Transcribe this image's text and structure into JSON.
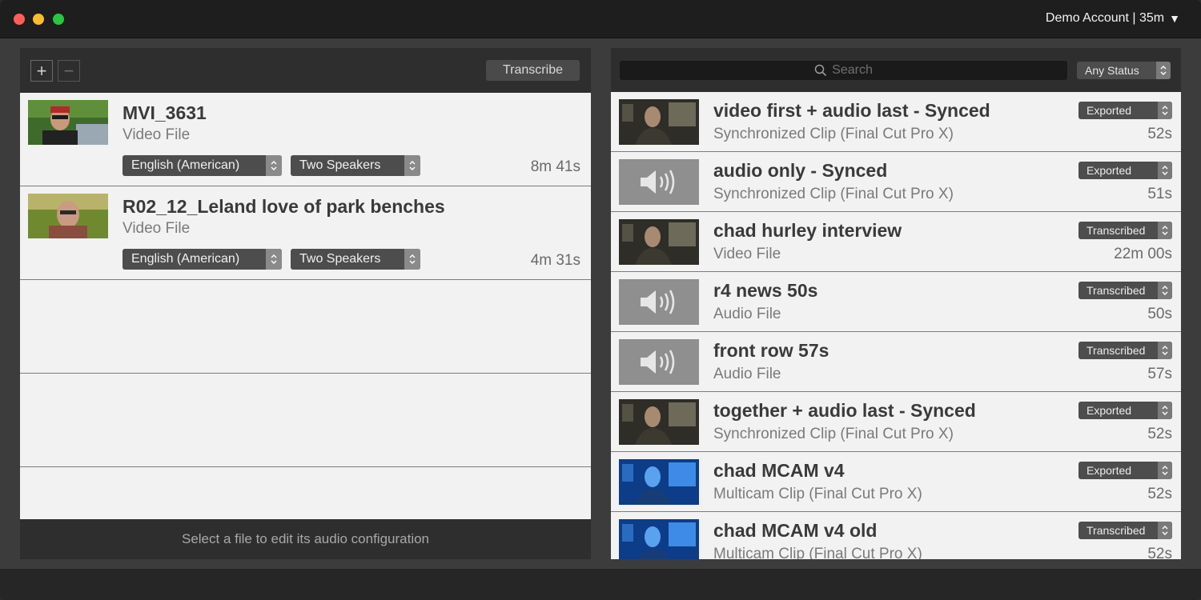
{
  "window": {
    "account_label": "Demo Account | 35m"
  },
  "left_panel": {
    "transcribe_label": "Transcribe",
    "files": [
      {
        "title": "MVI_3631",
        "subtitle": "Video File",
        "language": "English (American)",
        "speakers": "Two Speakers",
        "duration": "8m 41s"
      },
      {
        "title": "R02_12_Leland love of park benches",
        "subtitle": "Video File",
        "language": "English (American)",
        "speakers": "Two Speakers",
        "duration": "4m 31s"
      }
    ],
    "footer": "Select a file to edit its audio configuration"
  },
  "right_panel": {
    "search_placeholder": "Search",
    "status_filter": "Any Status",
    "items": [
      {
        "title": "video first + audio last - Synced",
        "subtitle": "Synchronized Clip (Final Cut Pro X)",
        "status": "Exported",
        "duration": "52s",
        "thumb": "video"
      },
      {
        "title": "audio only - Synced",
        "subtitle": "Synchronized Clip (Final Cut Pro X)",
        "status": "Exported",
        "duration": "51s",
        "thumb": "audio"
      },
      {
        "title": "chad hurley interview",
        "subtitle": "Video File",
        "status": "Transcribed",
        "duration": "22m 00s",
        "thumb": "video"
      },
      {
        "title": "r4 news 50s",
        "subtitle": "Audio File",
        "status": "Transcribed",
        "duration": "50s",
        "thumb": "audio"
      },
      {
        "title": "front row 57s",
        "subtitle": "Audio File",
        "status": "Transcribed",
        "duration": "57s",
        "thumb": "audio"
      },
      {
        "title": "together + audio last - Synced",
        "subtitle": "Synchronized Clip (Final Cut Pro X)",
        "status": "Exported",
        "duration": "52s",
        "thumb": "video"
      },
      {
        "title": "chad MCAM v4",
        "subtitle": "Multicam Clip (Final Cut Pro X)",
        "status": "Exported",
        "duration": "52s",
        "thumb": "video-blue"
      },
      {
        "title": "chad MCAM v4 old",
        "subtitle": "Multicam Clip (Final Cut Pro X)",
        "status": "Transcribed",
        "duration": "52s",
        "thumb": "video-blue"
      }
    ]
  },
  "icons": {
    "add": "plus-icon",
    "remove": "minus-icon",
    "search": "search-icon",
    "speaker": "speaker-icon",
    "stepper": "updown-chevron-icon",
    "account_menu": "triangle-down-icon"
  },
  "colors": {
    "titlebar": "#1e1e1e",
    "panel_bg": "#f2f2f2",
    "toolbar": "#2e2e2e",
    "popup": "#4d4d4d",
    "close": "#fc5f57",
    "minimize": "#fdbc2e",
    "maximize": "#27c840"
  }
}
